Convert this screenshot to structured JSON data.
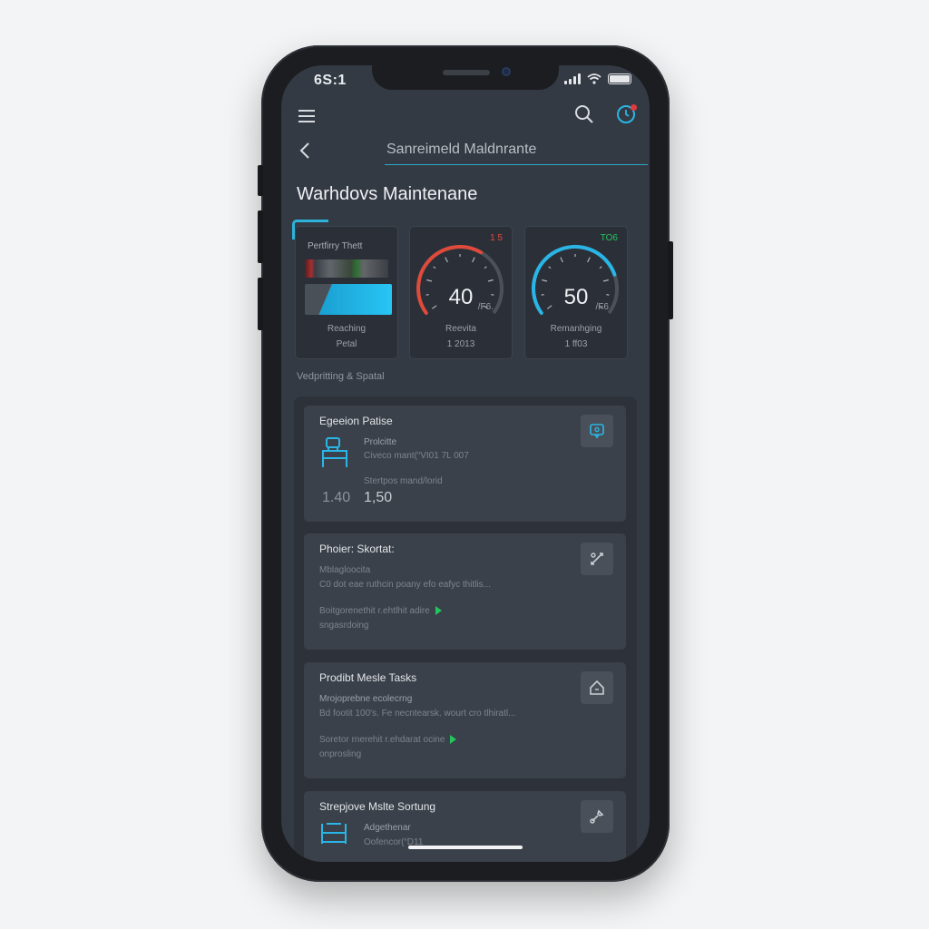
{
  "status_bar": {
    "time": "6S:1"
  },
  "nav": {
    "title": "Sanreimeld Maldnrante"
  },
  "page": {
    "title": "Warhdovs Maintenane"
  },
  "gauges": [
    {
      "title": "Pertfirry Thett",
      "label_1": "Reaching",
      "label_2": "Petal"
    },
    {
      "value": "40",
      "corner": "1 5",
      "unit": "/F6.",
      "label_1": "Reevita",
      "label_2": "1 2013",
      "color": "#e04a3b",
      "level": 0.62
    },
    {
      "value": "50",
      "corner": "TO6",
      "unit": "/F6",
      "label_1": "Remanhging",
      "label_2": "1 ff03",
      "color": "#29b6e6",
      "level": 0.78
    }
  ],
  "section": {
    "label": "Vedpritting & Spatal"
  },
  "tasks": [
    {
      "title": "Egeeion Patise",
      "line_1": "Prolcitte",
      "line_2": "Civeco mant(“VI01 7L 007",
      "line_3": "Stertpos mand/lorid",
      "value_a": "1.40",
      "value_b": "1,50"
    },
    {
      "title": "Phoier: Skortat:",
      "line_1": "Mblagloocita",
      "line_2": "C0 dot eae ruthcin poany efo eafyc thitlis...",
      "line_3": "Boitgorenethit r.ehtlhit adire",
      "line_4": "sngasrdoing"
    },
    {
      "title": "Prodibt Mesle Tasks",
      "line_1": "Mrojoprebne ecolecrng",
      "line_2": "Bd footit 100's. Fe necntearsk. wourt cro tlhiratl...",
      "line_3": "Soretor rnerehit r.ehdarat ocine",
      "line_4": "onprosling"
    },
    {
      "title": "Strepjove Mslte Sortung",
      "line_1": "Adgethenar",
      "line_2": "Oofencor(“D11"
    }
  ],
  "colors": {
    "accent": "#29b6e6",
    "alert": "#e04a3b",
    "play": "#22c55e"
  },
  "icons": [
    "menu-icon",
    "search-icon",
    "profile-icon",
    "back-icon",
    "forklift-icon",
    "chat-icon",
    "tools-icon",
    "home-icon",
    "wrench-icon",
    "rack-icon"
  ]
}
